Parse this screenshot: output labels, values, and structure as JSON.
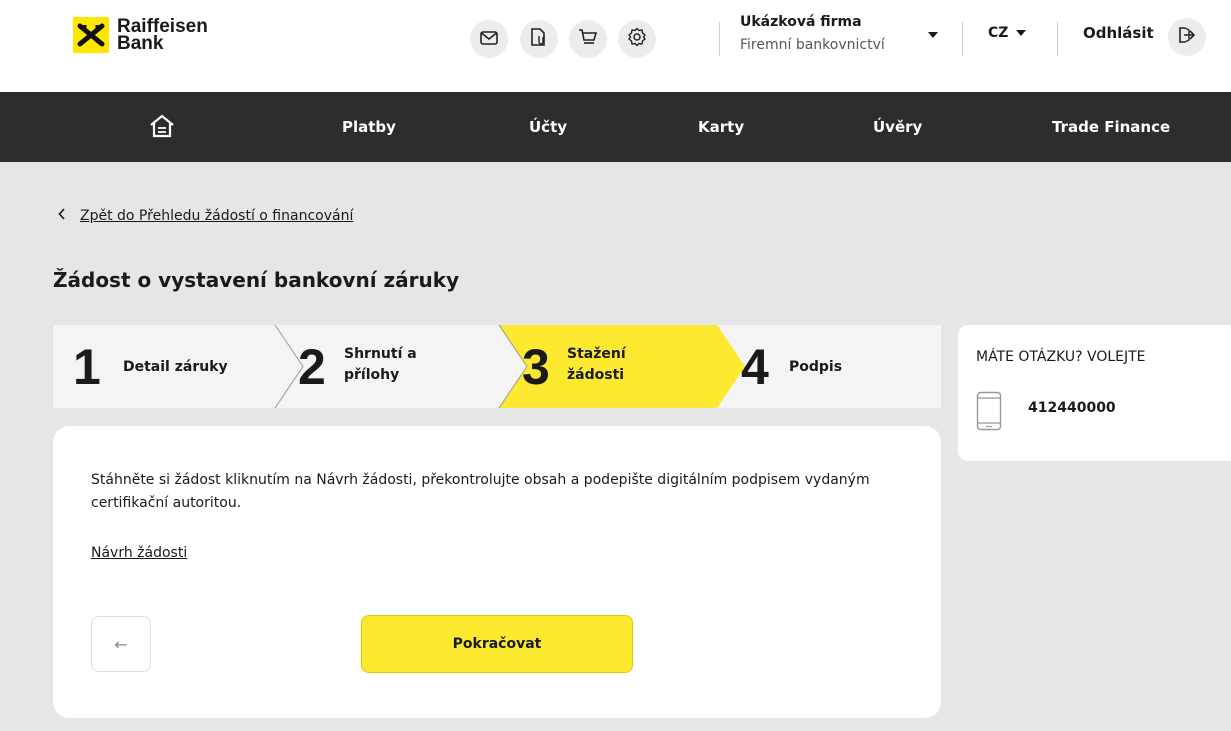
{
  "brand": {
    "line1": "Raiffeisen",
    "line2": "Bank",
    "accent": "#fee600"
  },
  "header": {
    "icons": [
      "mail-icon",
      "document-clip-icon",
      "cart-icon",
      "settings-icon"
    ],
    "company_name": "Ukázková firma",
    "company_sub": "Firemní bankovnictví",
    "language": "CZ",
    "logout_label": "Odhlásit"
  },
  "nav": {
    "items": [
      {
        "label": "Platby"
      },
      {
        "label": "Účty"
      },
      {
        "label": "Karty"
      },
      {
        "label": "Úvěry"
      },
      {
        "label": "Trade Finance"
      }
    ]
  },
  "back_link": "Zpět do Přehledu žádostí o financování",
  "page_title": "Žádost o vystavení bankovní záruky",
  "steps": [
    {
      "num": "1",
      "line1": "Detail záruky",
      "line2": "",
      "active": false
    },
    {
      "num": "2",
      "line1": "Shrnutí a",
      "line2": "přílohy",
      "active": false
    },
    {
      "num": "3",
      "line1": "Stažení",
      "line2": "žádosti",
      "active": true
    },
    {
      "num": "4",
      "line1": "Podpis",
      "line2": "",
      "active": false
    }
  ],
  "content": {
    "description": "Stáhněte si žádost kliknutím na Návrh žádosti, překontrolujte obsah a podepište digitálním podpisem vydaným certifikační autoritou.",
    "draft_link": "Návrh žádosti",
    "back_arrow": "←",
    "continue_label": "Pokračovat"
  },
  "help": {
    "title": "MÁTE OTÁZKU? VOLEJTE",
    "phone": "412440000"
  }
}
